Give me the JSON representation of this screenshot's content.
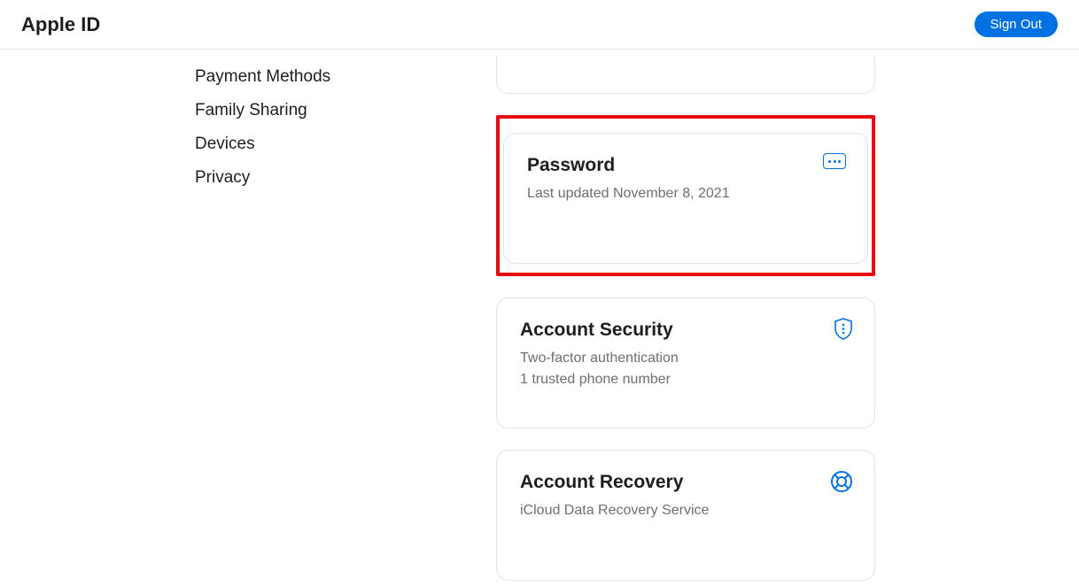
{
  "header": {
    "title": "Apple ID",
    "signOut": "Sign Out"
  },
  "sidebar": {
    "items": [
      "Payment Methods",
      "Family Sharing",
      "Devices",
      "Privacy"
    ]
  },
  "cards": {
    "password": {
      "title": "Password",
      "subtext": "Last updated November 8, 2021"
    },
    "security": {
      "title": "Account Security",
      "line1": "Two-factor authentication",
      "line2": "1 trusted phone number"
    },
    "recovery": {
      "title": "Account Recovery",
      "subtext": "iCloud Data Recovery Service"
    }
  }
}
